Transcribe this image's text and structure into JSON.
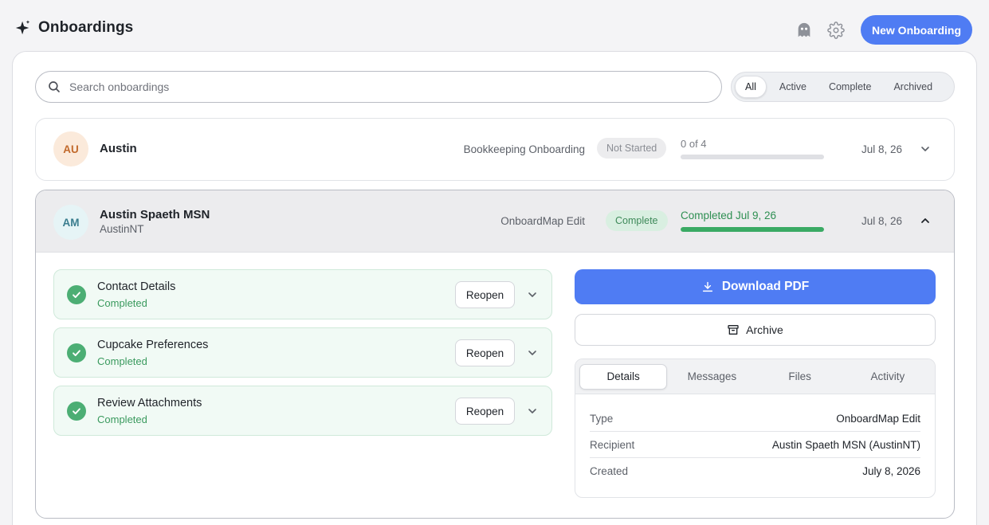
{
  "header": {
    "title": "Onboardings",
    "new_button": "New Onboarding",
    "accent_color": "#4f7cf3"
  },
  "search": {
    "placeholder": "Search onboardings",
    "value": ""
  },
  "filters": [
    {
      "label": "All",
      "active": true
    },
    {
      "label": "Active",
      "active": false
    },
    {
      "label": "Complete",
      "active": false
    },
    {
      "label": "Archived",
      "active": false
    }
  ],
  "onboardings": [
    {
      "initials": "AU",
      "name": "Austin",
      "subname": "",
      "type": "Bookkeeping Onboarding",
      "status": "Not Started",
      "progress_label": "0 of 4",
      "progress": 0,
      "date": "Jul 8, 26",
      "expanded": false
    },
    {
      "initials": "AM",
      "name": "Austin Spaeth MSN",
      "subname": "AustinNT",
      "type": "OnboardMap Edit",
      "status": "Complete",
      "progress_label": "Completed Jul 9, 26",
      "progress": 1.0,
      "date": "Jul 8, 26",
      "expanded": true,
      "steps": [
        {
          "title": "Contact Details",
          "status": "Completed",
          "action": "Reopen"
        },
        {
          "title": "Cupcake Preferences",
          "status": "Completed",
          "action": "Reopen"
        },
        {
          "title": "Review Attachments",
          "status": "Completed",
          "action": "Reopen"
        }
      ],
      "actions": {
        "download": "Download PDF",
        "archive": "Archive"
      },
      "tabs": [
        {
          "label": "Details",
          "active": true
        },
        {
          "label": "Messages",
          "active": false
        },
        {
          "label": "Files",
          "active": false
        },
        {
          "label": "Activity",
          "active": false
        }
      ],
      "details": [
        {
          "key": "Type",
          "value": "OnboardMap Edit"
        },
        {
          "key": "Recipient",
          "value": "Austin Spaeth MSN (AustinNT)"
        },
        {
          "key": "Created",
          "value": "July 8, 2026"
        }
      ]
    }
  ]
}
